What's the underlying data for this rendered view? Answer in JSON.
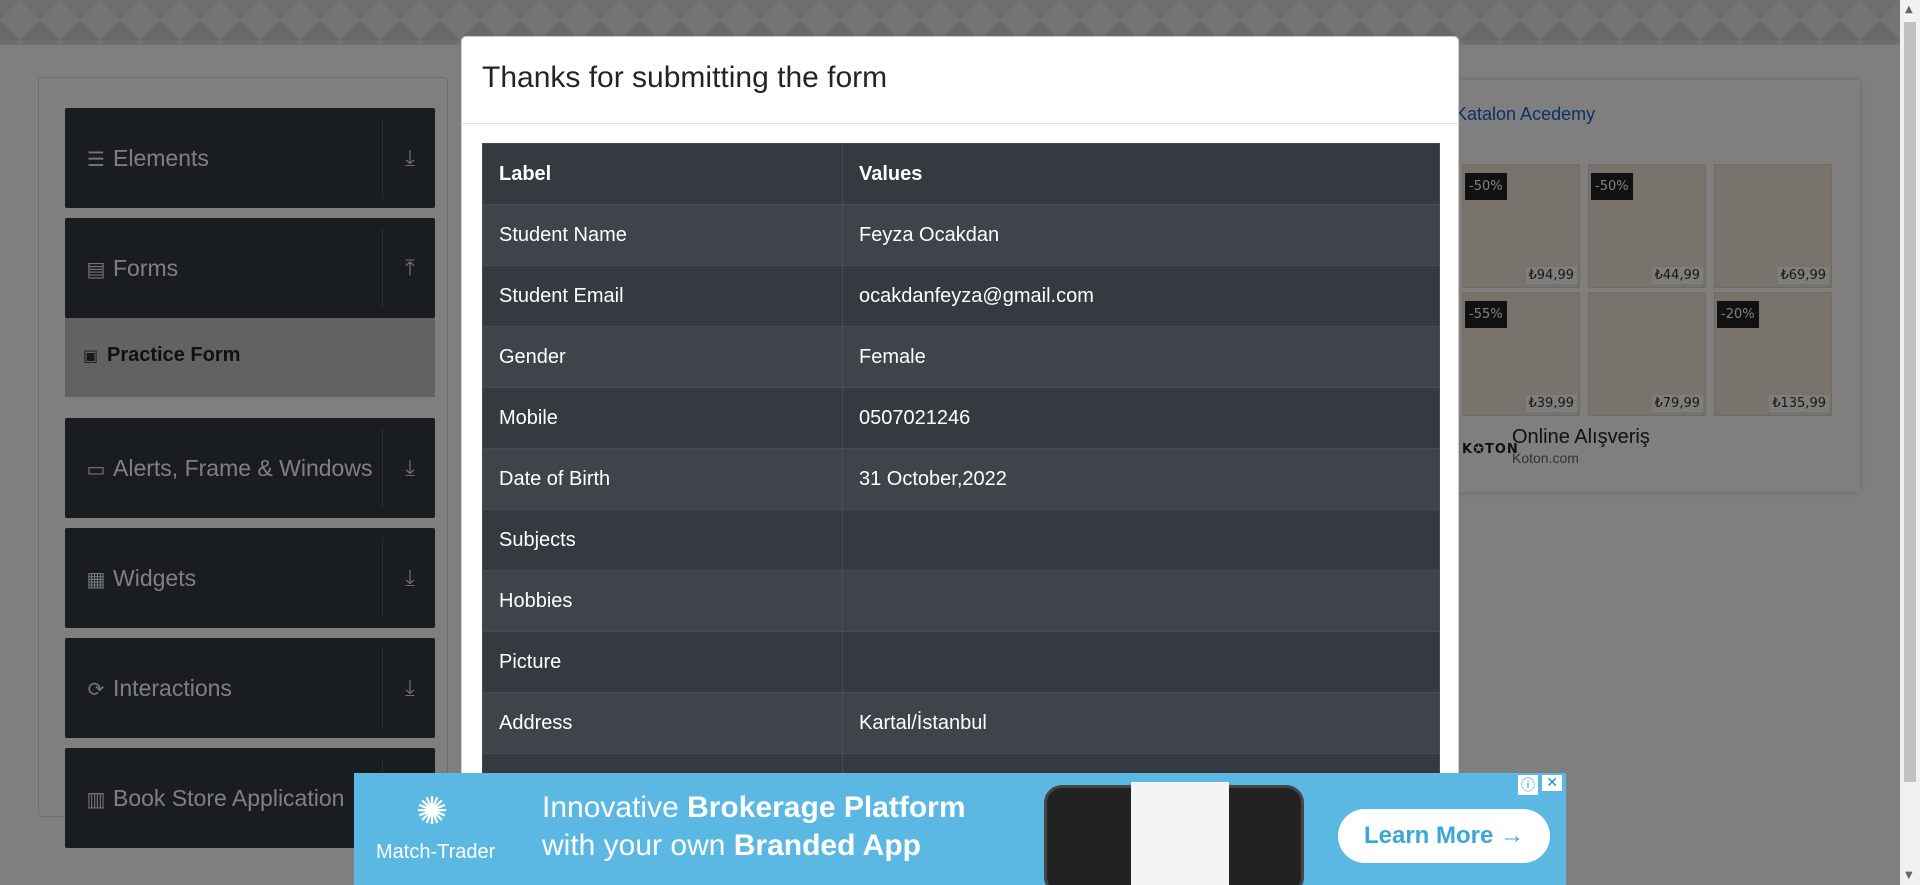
{
  "sidebar": {
    "groups": [
      {
        "label": "Elements",
        "icon": "hamburger-icon"
      },
      {
        "label": "Forms",
        "icon": "document-icon"
      },
      {
        "label": "Alerts, Frame & Windows",
        "icon": "window-icon"
      },
      {
        "label": "Widgets",
        "icon": "widgets-icon"
      },
      {
        "label": "Interactions",
        "icon": "interactions-icon"
      },
      {
        "label": "Book Store Application",
        "icon": "books-icon"
      }
    ],
    "active_item": "Practice Form"
  },
  "right_ad": {
    "link_text": "Katalon Acedemy",
    "tiles": [
      {
        "discount": "-50%",
        "price": "₺94,99"
      },
      {
        "discount": "-50%",
        "price": "₺44,99"
      },
      {
        "discount": "",
        "price": "₺69,99"
      },
      {
        "discount": "-55%",
        "price": "₺39,99"
      },
      {
        "discount": "",
        "price": "₺79,99"
      },
      {
        "discount": "-20%",
        "price": "₺135,99"
      }
    ],
    "brand_logo": "K✪TON",
    "title": "Online Alışveriş",
    "subtitle": "Koton.com"
  },
  "modal": {
    "title": "Thanks for submitting the form",
    "columns": [
      "Label",
      "Values"
    ],
    "rows": [
      {
        "label": "Student Name",
        "value": "Feyza Ocakdan"
      },
      {
        "label": "Student Email",
        "value": "ocakdanfeyza@gmail.com"
      },
      {
        "label": "Gender",
        "value": "Female"
      },
      {
        "label": "Mobile",
        "value": "0507021246"
      },
      {
        "label": "Date of Birth",
        "value": "31 October,2022"
      },
      {
        "label": "Subjects",
        "value": ""
      },
      {
        "label": "Hobbies",
        "value": ""
      },
      {
        "label": "Picture",
        "value": ""
      },
      {
        "label": "Address",
        "value": "Kartal/İstanbul"
      }
    ]
  },
  "bottom_ad": {
    "brand": "Match-Trader",
    "line1_prefix": "Innovative ",
    "line1_bold": "Brokerage Platform",
    "line2_prefix": "with your own ",
    "line2_bold": "Branded App",
    "cta": "Learn More →"
  }
}
